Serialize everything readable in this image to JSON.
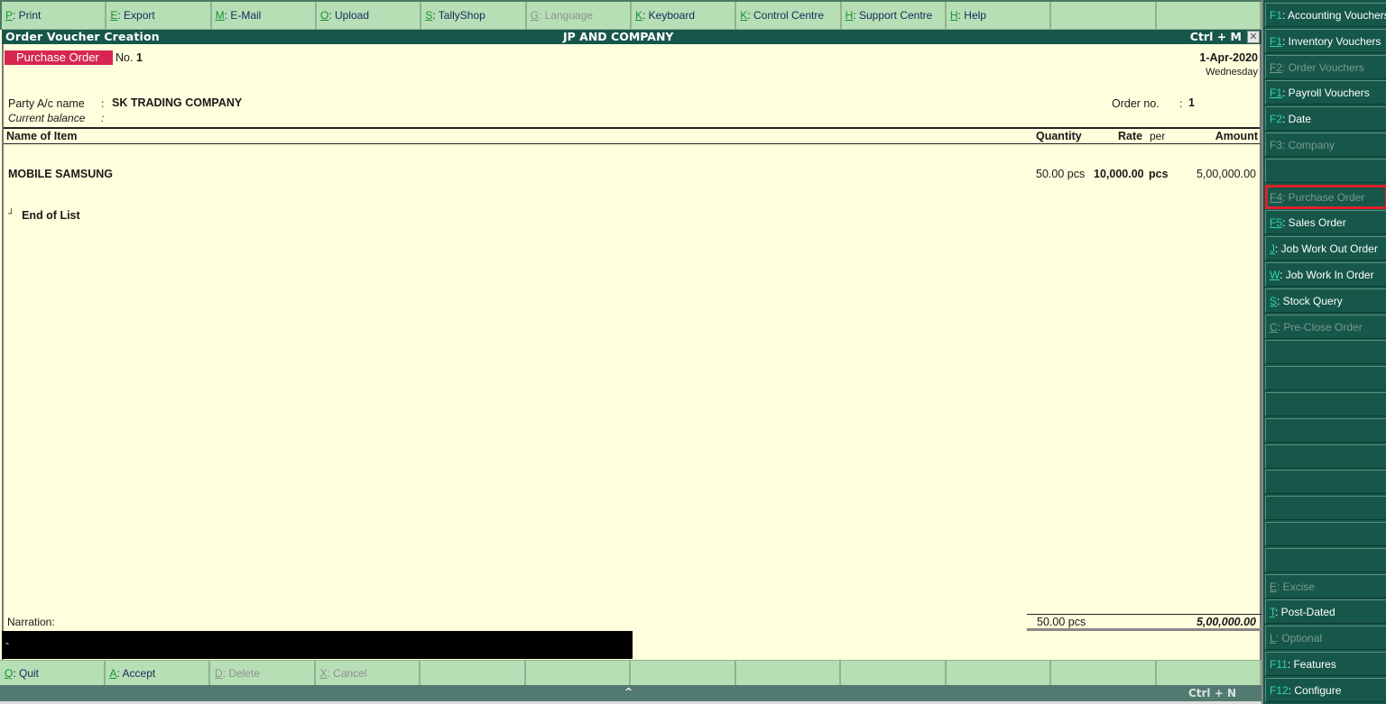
{
  "top_menu": [
    {
      "key": "P",
      "label": ": Print",
      "enabled": true
    },
    {
      "key": "E",
      "label": ": Export",
      "enabled": true
    },
    {
      "key": "M",
      "label": ": E-Mail",
      "enabled": true
    },
    {
      "key": "O",
      "label": ": Upload",
      "enabled": true
    },
    {
      "key": "S",
      "label": ": TallyShop",
      "enabled": true
    },
    {
      "key": "G",
      "label": ": Language",
      "enabled": false
    },
    {
      "key": "K",
      "label": ": Keyboard",
      "enabled": true
    },
    {
      "key": "K",
      "label": ": Control Centre",
      "enabled": true
    },
    {
      "key": "H",
      "label": ": Support Centre",
      "enabled": true
    },
    {
      "key": "H",
      "label": ": Help",
      "enabled": true
    },
    {
      "key": "",
      "label": "",
      "enabled": true
    },
    {
      "key": "",
      "label": "",
      "enabled": true
    }
  ],
  "titlebar": {
    "title": "Order Voucher  Creation",
    "company": "JP AND COMPANY",
    "shortcut": "Ctrl + M",
    "close": "✕"
  },
  "voucher": {
    "type": "Purchase Order",
    "no_label": "No.",
    "no_value": "1",
    "date": "1-Apr-2020",
    "day": "Wednesday",
    "party_label": "Party A/c name",
    "party_value": "SK TRADING COMPANY",
    "balance_label": "Current balance",
    "colon": ":",
    "order_no_label": "Order no.",
    "order_no_value": "1"
  },
  "table": {
    "headers": {
      "name": "Name of Item",
      "quantity": "Quantity",
      "rate": "Rate",
      "per": "per",
      "amount": "Amount"
    },
    "rows": [
      {
        "name": "MOBILE SAMSUNG",
        "quantity": "50.00 pcs",
        "rate": "10,000.00",
        "per": "pcs",
        "amount": "5,00,000.00"
      }
    ],
    "end_marker": "┘",
    "end_label": "End of List"
  },
  "footer": {
    "narration_label": "Narration:",
    "narration_value": "-",
    "total_quantity": "50.00 pcs",
    "total_amount": "5,00,000.00"
  },
  "bottom_menu": [
    {
      "key": "Q",
      "label": ": Quit",
      "enabled": true
    },
    {
      "key": "A",
      "label": ": Accept",
      "enabled": true
    },
    {
      "key": "D",
      "label": ": Delete",
      "enabled": false
    },
    {
      "key": "X",
      "label": ": Cancel",
      "enabled": false
    },
    {
      "key": "",
      "label": "",
      "enabled": true
    },
    {
      "key": "",
      "label": "",
      "enabled": true
    },
    {
      "key": "",
      "label": "",
      "enabled": true
    },
    {
      "key": "",
      "label": "",
      "enabled": true
    },
    {
      "key": "",
      "label": "",
      "enabled": true
    },
    {
      "key": "",
      "label": "",
      "enabled": true
    },
    {
      "key": "",
      "label": "",
      "enabled": true
    },
    {
      "key": "",
      "label": "",
      "enabled": true
    }
  ],
  "statusbar": {
    "up_arrow": "^",
    "shortcut": "Ctrl + N"
  },
  "right_panel": [
    {
      "key": "F1",
      "label": ": Accounting Vouchers",
      "enabled": true,
      "underline": false
    },
    {
      "key": "F1",
      "label": ": Inventory Vouchers",
      "enabled": true,
      "underline": true
    },
    {
      "key": "F2",
      "label": ": Order Vouchers",
      "enabled": false,
      "underline": true
    },
    {
      "key": "F1",
      "label": ": Payroll Vouchers",
      "enabled": true,
      "underline": true
    },
    {
      "key": "F2",
      "label": ": Date",
      "enabled": true,
      "underline": false
    },
    {
      "key": "F3",
      "label": ": Company",
      "enabled": false,
      "underline": false
    },
    {
      "key": "",
      "label": "",
      "enabled": true,
      "underline": false
    },
    {
      "key": "F4",
      "label": ": Purchase Order",
      "enabled": false,
      "underline": true,
      "highlighted": true
    },
    {
      "key": "F5",
      "label": ": Sales Order",
      "enabled": true,
      "underline": true
    },
    {
      "key": "J",
      "label": ": Job Work Out Order",
      "enabled": true,
      "underline": true
    },
    {
      "key": "W",
      "label": ": Job Work In Order",
      "enabled": true,
      "underline": true
    },
    {
      "key": "S",
      "label": ": Stock Query",
      "enabled": true,
      "underline": true
    },
    {
      "key": "C",
      "label": ": Pre-Close Order",
      "enabled": false,
      "underline": true
    },
    {
      "key": "",
      "label": "",
      "enabled": true
    },
    {
      "key": "",
      "label": "",
      "enabled": true
    },
    {
      "key": "",
      "label": "",
      "enabled": true
    },
    {
      "key": "",
      "label": "",
      "enabled": true
    },
    {
      "key": "",
      "label": "",
      "enabled": true
    },
    {
      "key": "",
      "label": "",
      "enabled": true
    },
    {
      "key": "",
      "label": "",
      "enabled": true
    },
    {
      "key": "",
      "label": "",
      "enabled": true
    },
    {
      "key": "",
      "label": "",
      "enabled": true
    },
    {
      "key": "E",
      "label": ": Excise",
      "enabled": false,
      "underline": true
    },
    {
      "key": "T",
      "label": ": Post-Dated",
      "enabled": true,
      "underline": true
    },
    {
      "key": "L",
      "label": ": Optional",
      "enabled": false,
      "underline": true
    },
    {
      "key": "F11",
      "label": ": Features",
      "enabled": true,
      "underline": false
    },
    {
      "key": "F12",
      "label": ": Configure",
      "enabled": true,
      "underline": false
    }
  ],
  "colors": {
    "accent_green": "#16574a",
    "voucher_type_bg": "#d7264f",
    "menu_bg": "#b6dfb6",
    "content_bg": "#ffffdd",
    "highlight_box": "#e0202a"
  }
}
